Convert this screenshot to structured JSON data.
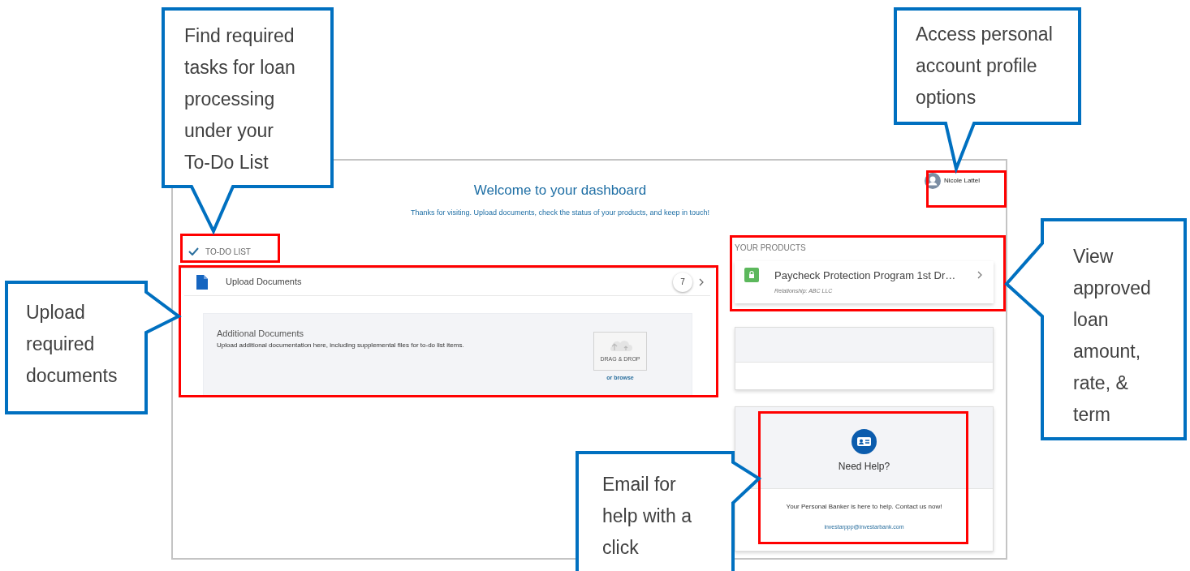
{
  "dashboard": {
    "title": "Welcome to your dashboard",
    "subtitle": "Thanks for visiting. Upload documents, check the status of your products, and keep in touch!",
    "user": {
      "name": "Nicole Lattel"
    },
    "todo": {
      "heading": "TO-DO LIST",
      "tasks": [
        {
          "title": "Upload Documents",
          "count": "7"
        }
      ],
      "upload_panel": {
        "title": "Additional Documents",
        "description": "Upload additional documentation here, including supplemental files for to-do list items.",
        "dropzone_label": "DRAG & DROP",
        "browse_link": "or browse"
      }
    },
    "products": {
      "heading": "YOUR PRODUCTS",
      "items": [
        {
          "name": "Paycheck Protection Program 1st Dr…",
          "relationship": "Relationship: ABC LLC"
        }
      ]
    },
    "help": {
      "title": "Need Help?",
      "message": "Your Personal Banker is here to help. Contact us now!",
      "email": "investarppp@investarbank.com"
    }
  },
  "callouts": [
    {
      "text": "Find required tasks for loan processing under your To-Do List"
    },
    {
      "text": "Access personal account profile options"
    },
    {
      "text": "Upload required documents"
    },
    {
      "text": "View approved loan amount, rate, & term"
    },
    {
      "text": "Email for help with a click"
    }
  ]
}
